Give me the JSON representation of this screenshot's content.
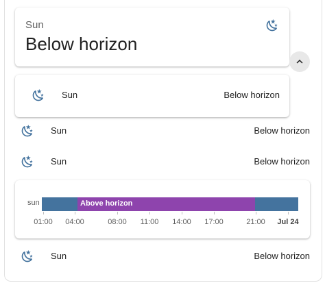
{
  "colors": {
    "icon": "#44739e",
    "below_horizon_bar": "#44739e",
    "above_horizon_bar": "#8e44ad"
  },
  "header_card": {
    "name": "Sun",
    "state": "Below horizon",
    "icon": "weather-night-icon"
  },
  "collapse_button": {
    "icon": "chevron-up-icon"
  },
  "entity_rows": [
    {
      "name": "Sun",
      "state": "Below horizon",
      "icon": "weather-night-icon"
    },
    {
      "name": "Sun",
      "state": "Below horizon",
      "icon": "weather-night-icon"
    },
    {
      "name": "Sun",
      "state": "Below horizon",
      "icon": "weather-night-icon"
    },
    {
      "name": "Sun",
      "state": "Below horizon",
      "icon": "weather-night-icon"
    }
  ],
  "timeline": {
    "series_label": "sun",
    "segments": [
      {
        "state": "Below horizon",
        "label": "",
        "start": "01:00",
        "end": "05:08",
        "color": "#44739e"
      },
      {
        "state": "Above horizon",
        "label": "Above horizon",
        "start": "05:08",
        "end": "21:00",
        "color": "#8e44ad"
      },
      {
        "state": "Below horizon",
        "label": "",
        "start": "21:00",
        "end": "Jul 24 00:56",
        "color": "#44739e"
      }
    ],
    "ticks": [
      "01:00",
      "04:00",
      "08:00",
      "11:00",
      "14:00",
      "17:00",
      "21:00",
      "Jul 24"
    ]
  }
}
